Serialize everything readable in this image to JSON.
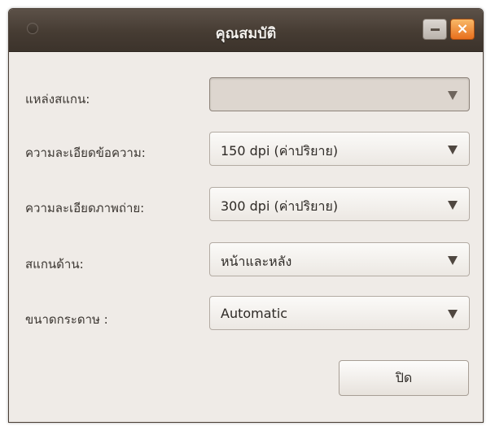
{
  "window": {
    "title": "คุณสมบัติ",
    "minimize_glyph": "–",
    "close_glyph": "×"
  },
  "fields": [
    {
      "label": "แหล่งสแกน:",
      "value": "",
      "enabled": false
    },
    {
      "label": "ความละเอียดข้อความ:",
      "value": "150 dpi (ค่าปริยาย)",
      "enabled": true
    },
    {
      "label": "ความละเอียดภาพถ่าย:",
      "value": "300 dpi (ค่าปริยาย)",
      "enabled": true
    },
    {
      "label": "สแกนด้าน:",
      "value": "หน้าและหลัง",
      "enabled": true
    },
    {
      "label": "ขนาดกระดาษ :",
      "value": "Automatic",
      "enabled": true
    }
  ],
  "buttons": {
    "close_label": "ปิด"
  },
  "icons": {
    "window_menu": "window-menu-icon",
    "minimize": "minimize-icon",
    "close": "close-icon",
    "dropdown": "dropdown-arrow-icon"
  },
  "colors": {
    "titlebar": "#463c33",
    "window_bg": "#efebe7",
    "close_button": "#e86f1d"
  }
}
